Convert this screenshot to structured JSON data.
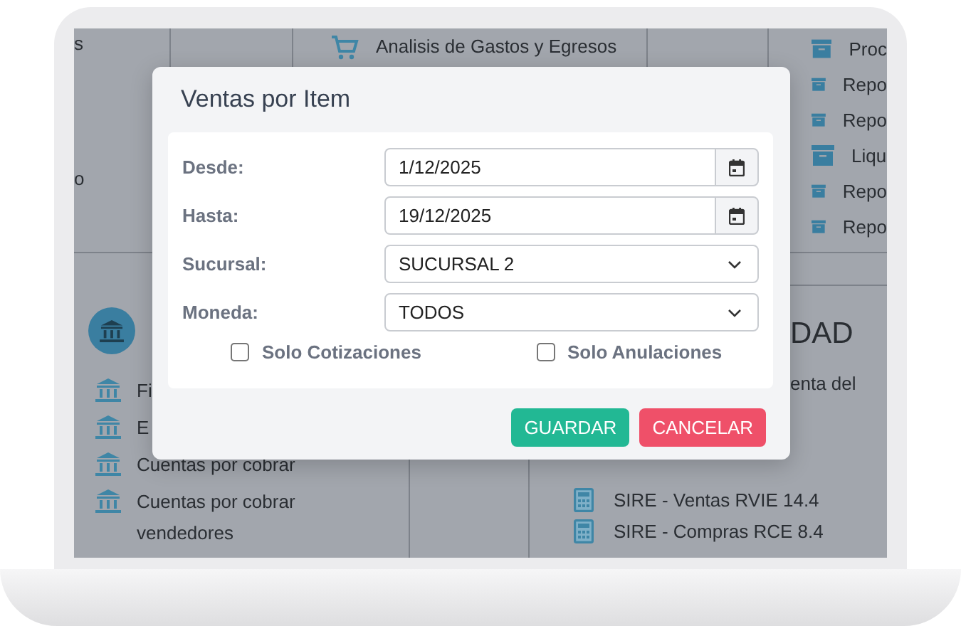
{
  "background": {
    "cut_texts": [
      "s",
      "o"
    ],
    "expense_report": "Analisis de Gastos y Egresos",
    "report_list": [
      "Proc",
      "Repo",
      "Repo",
      "Liqu",
      "Repo",
      "Repo"
    ],
    "finance_list": [
      "Fi",
      "E",
      "Cuentas por cobrar",
      "Cuentas por cobrar vendedores"
    ],
    "accounting_panel": {
      "heading": "DAD",
      "items": [
        "enta del",
        "SIRE - Ventas RVIE 14.4",
        "SIRE - Compras RCE 8.4"
      ]
    }
  },
  "dialog": {
    "title": "Ventas por Item",
    "fields": [
      {
        "label": "Desde:",
        "value": "1/12/2025",
        "kind": "date"
      },
      {
        "label": "Hasta:",
        "value": "19/12/2025",
        "kind": "date"
      },
      {
        "label": "Sucursal:",
        "value": "SUCURSAL 2",
        "kind": "select"
      },
      {
        "label": "Moneda:",
        "value": "TODOS",
        "kind": "select"
      }
    ],
    "options": [
      {
        "label": "Solo Cotizaciones",
        "checked": false
      },
      {
        "label": "Solo Anulaciones",
        "checked": false
      }
    ],
    "buttons": [
      {
        "label": "GUARDAR",
        "kind": "confirm"
      },
      {
        "label": "CANCELAR",
        "kind": "cancel"
      }
    ]
  }
}
